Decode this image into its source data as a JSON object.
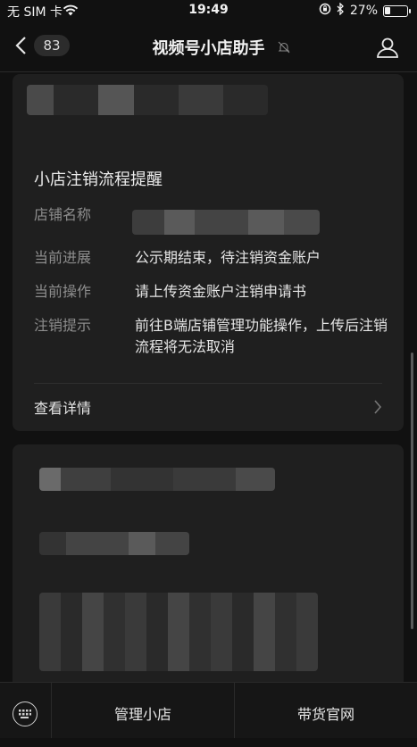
{
  "status_bar": {
    "carrier": "无 SIM 卡",
    "time": "19:49",
    "battery": "27%",
    "battery_level": 0.27
  },
  "nav": {
    "unread_count": "83",
    "title": "视频号小店助手"
  },
  "notice": {
    "title": "小店注销流程提醒",
    "rows": [
      {
        "label": "店铺名称",
        "value": ""
      },
      {
        "label": "当前进展",
        "value": "公示期结束，待注销资金账户"
      },
      {
        "label": "当前操作",
        "value": "请上传资金账户注销申请书"
      },
      {
        "label": "注销提示",
        "value": "前往B端店铺管理功能操作，上传后注销流程将无法取消"
      }
    ],
    "details_label": "查看详情"
  },
  "bottom_menu": {
    "items": [
      "管理小店",
      "带货官网"
    ]
  },
  "icons": [
    "wifi-icon",
    "bluetooth-icon",
    "rotation-lock-icon",
    "battery-icon",
    "back-chevron-icon",
    "mute-bell-icon",
    "user-icon",
    "chevron-right-icon",
    "keyboard-icon"
  ]
}
